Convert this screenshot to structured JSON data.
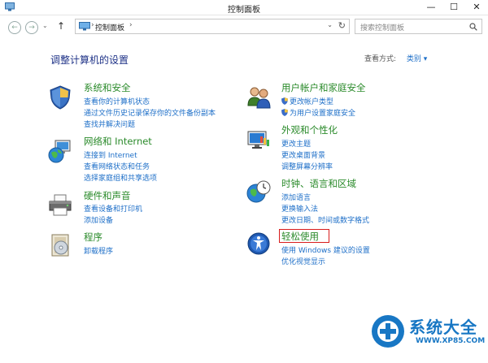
{
  "window": {
    "title": "控制面板",
    "minimize": "—",
    "maximize": "☐",
    "close": "✕"
  },
  "nav": {
    "back": "←",
    "forward": "→",
    "dropdown": "⌄",
    "up": "↑"
  },
  "address": {
    "crumb": "控制面板",
    "sep": "›",
    "dropdown": "⌄",
    "refresh": "↻"
  },
  "search": {
    "placeholder": "搜索控制面板",
    "icon": "search-icon"
  },
  "main": {
    "heading": "调整计算机的设置",
    "view_by_label": "查看方式:",
    "view_by_value": "类别 ▾"
  },
  "categories_left": [
    {
      "title": "系统和安全",
      "icon": "shield-icon",
      "links": [
        "查看你的计算机状态",
        "通过文件历史记录保存你的文件备份副本",
        "查找并解决问题"
      ]
    },
    {
      "title": "网络和 Internet",
      "icon": "network-globe-icon",
      "links": [
        "连接到 Internet",
        "查看网络状态和任务",
        "选择家庭组和共享选项"
      ]
    },
    {
      "title": "硬件和声音",
      "icon": "printer-icon",
      "links": [
        "查看设备和打印机",
        "添加设备"
      ]
    },
    {
      "title": "程序",
      "icon": "programs-icon",
      "links": [
        "卸载程序"
      ]
    }
  ],
  "categories_right": [
    {
      "title": "用户帐户和家庭安全",
      "icon": "users-icon",
      "links": [
        "更改帐户类型",
        "为用户设置家庭安全"
      ]
    },
    {
      "title": "外观和个性化",
      "icon": "appearance-icon",
      "links": [
        "更改主题",
        "更改桌面背景",
        "调整屏幕分辨率"
      ]
    },
    {
      "title": "时钟、语言和区域",
      "icon": "clock-globe-icon",
      "links": [
        "添加语言",
        "更换输入法",
        "更改日期、时间或数字格式"
      ]
    },
    {
      "title": "轻松使用",
      "icon": "ease-of-access-icon",
      "links": [
        "使用 Windows 建议的设置",
        "优化视觉显示"
      ]
    }
  ],
  "watermark": {
    "text": "系统大全",
    "url": "WWW.XP85.COM"
  },
  "colors": {
    "heading": "#1e3287",
    "link": "#1e6fc8",
    "category": "#2a8a2a",
    "highlight": "#d81c1c",
    "watermark": "#1877c4"
  }
}
